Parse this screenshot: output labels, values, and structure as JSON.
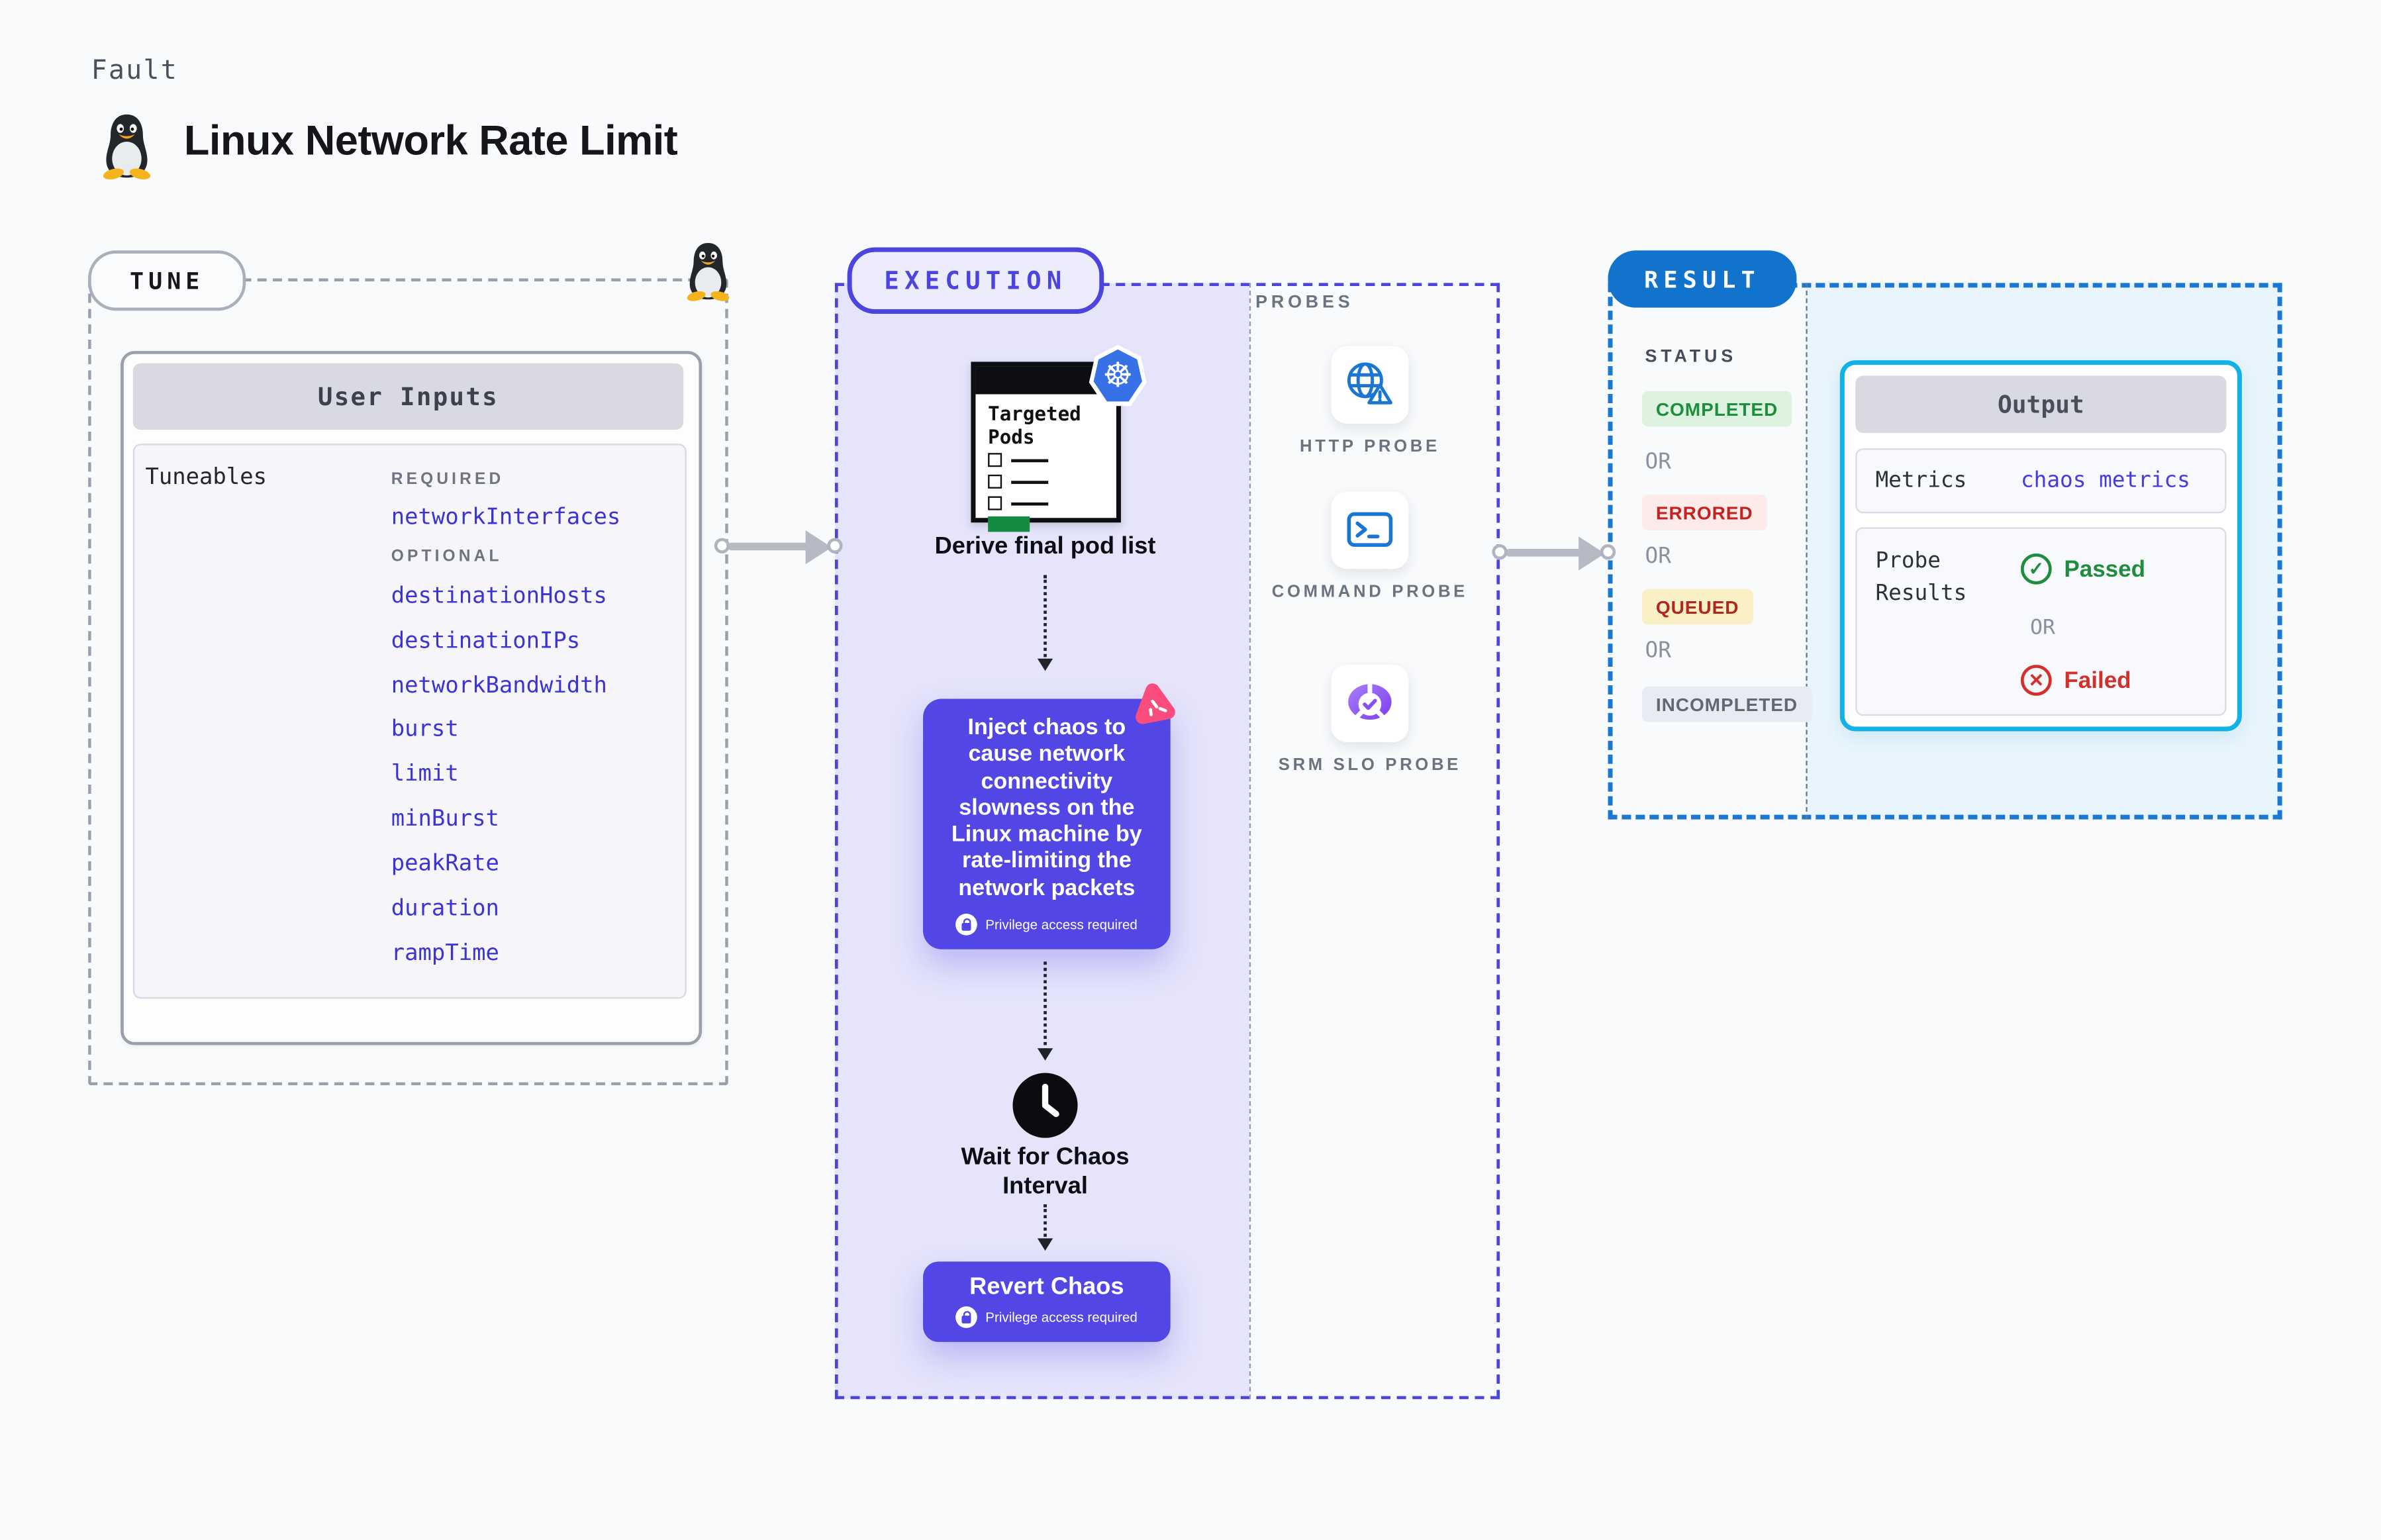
{
  "page": {
    "kicker": "Fault",
    "title": "Linux Network Rate Limit",
    "background": "#f8fafc",
    "os_icon": "linux-tux"
  },
  "tune": {
    "label": "TUNE",
    "card_title": "User Inputs",
    "panel_label": "Tuneables",
    "required_label": "REQUIRED",
    "required_items": [
      "networkInterfaces"
    ],
    "optional_label": "OPTIONAL",
    "optional_items": [
      "destinationHosts",
      "destinationIPs",
      "networkBandwidth",
      "burst",
      "limit",
      "minBurst",
      "peakRate",
      "duration",
      "rampTime"
    ],
    "link_color": "#3b33d6"
  },
  "execution": {
    "label": "EXECUTION",
    "accent": "#5247e5",
    "clipboard_title": "Targeted Pods",
    "derive_label": "Derive final pod list",
    "inject_text": "Inject chaos to cause network connectivity slowness on the Linux machine by rate-limiting the network packets",
    "privilege_label": "Privilege access required",
    "wait_label": "Wait for Chaos Interval",
    "revert_label": "Revert Chaos"
  },
  "probes": {
    "label": "PROBES",
    "items": [
      {
        "label": "HTTP PROBE",
        "icon": "globe-warning-icon"
      },
      {
        "label": "COMMAND PROBE",
        "icon": "terminal-icon"
      },
      {
        "label": "SRM SLO PROBE",
        "icon": "slo-gauge-icon"
      }
    ]
  },
  "result": {
    "label": "RESULT",
    "pill_color": "#1273cc",
    "status_label": "STATUS",
    "or_label": "OR",
    "statuses": [
      {
        "label": "COMPLETED",
        "fg": "#1e8e3e",
        "bg": "#def3df"
      },
      {
        "label": "ERRORED",
        "fg": "#c5221f",
        "bg": "#fcebe9"
      },
      {
        "label": "QUEUED",
        "fg": "#b3261e",
        "bg": "#faf0c5"
      },
      {
        "label": "INCOMPLETED",
        "fg": "#5f6875",
        "bg": "#e9ebf2"
      }
    ],
    "output": {
      "title": "Output",
      "metrics_label": "Metrics",
      "metrics_value": "chaos metrics",
      "probe_results_label": "Probe Results",
      "passed_label": "Passed",
      "or_label": "OR",
      "failed_label": "Failed"
    }
  }
}
